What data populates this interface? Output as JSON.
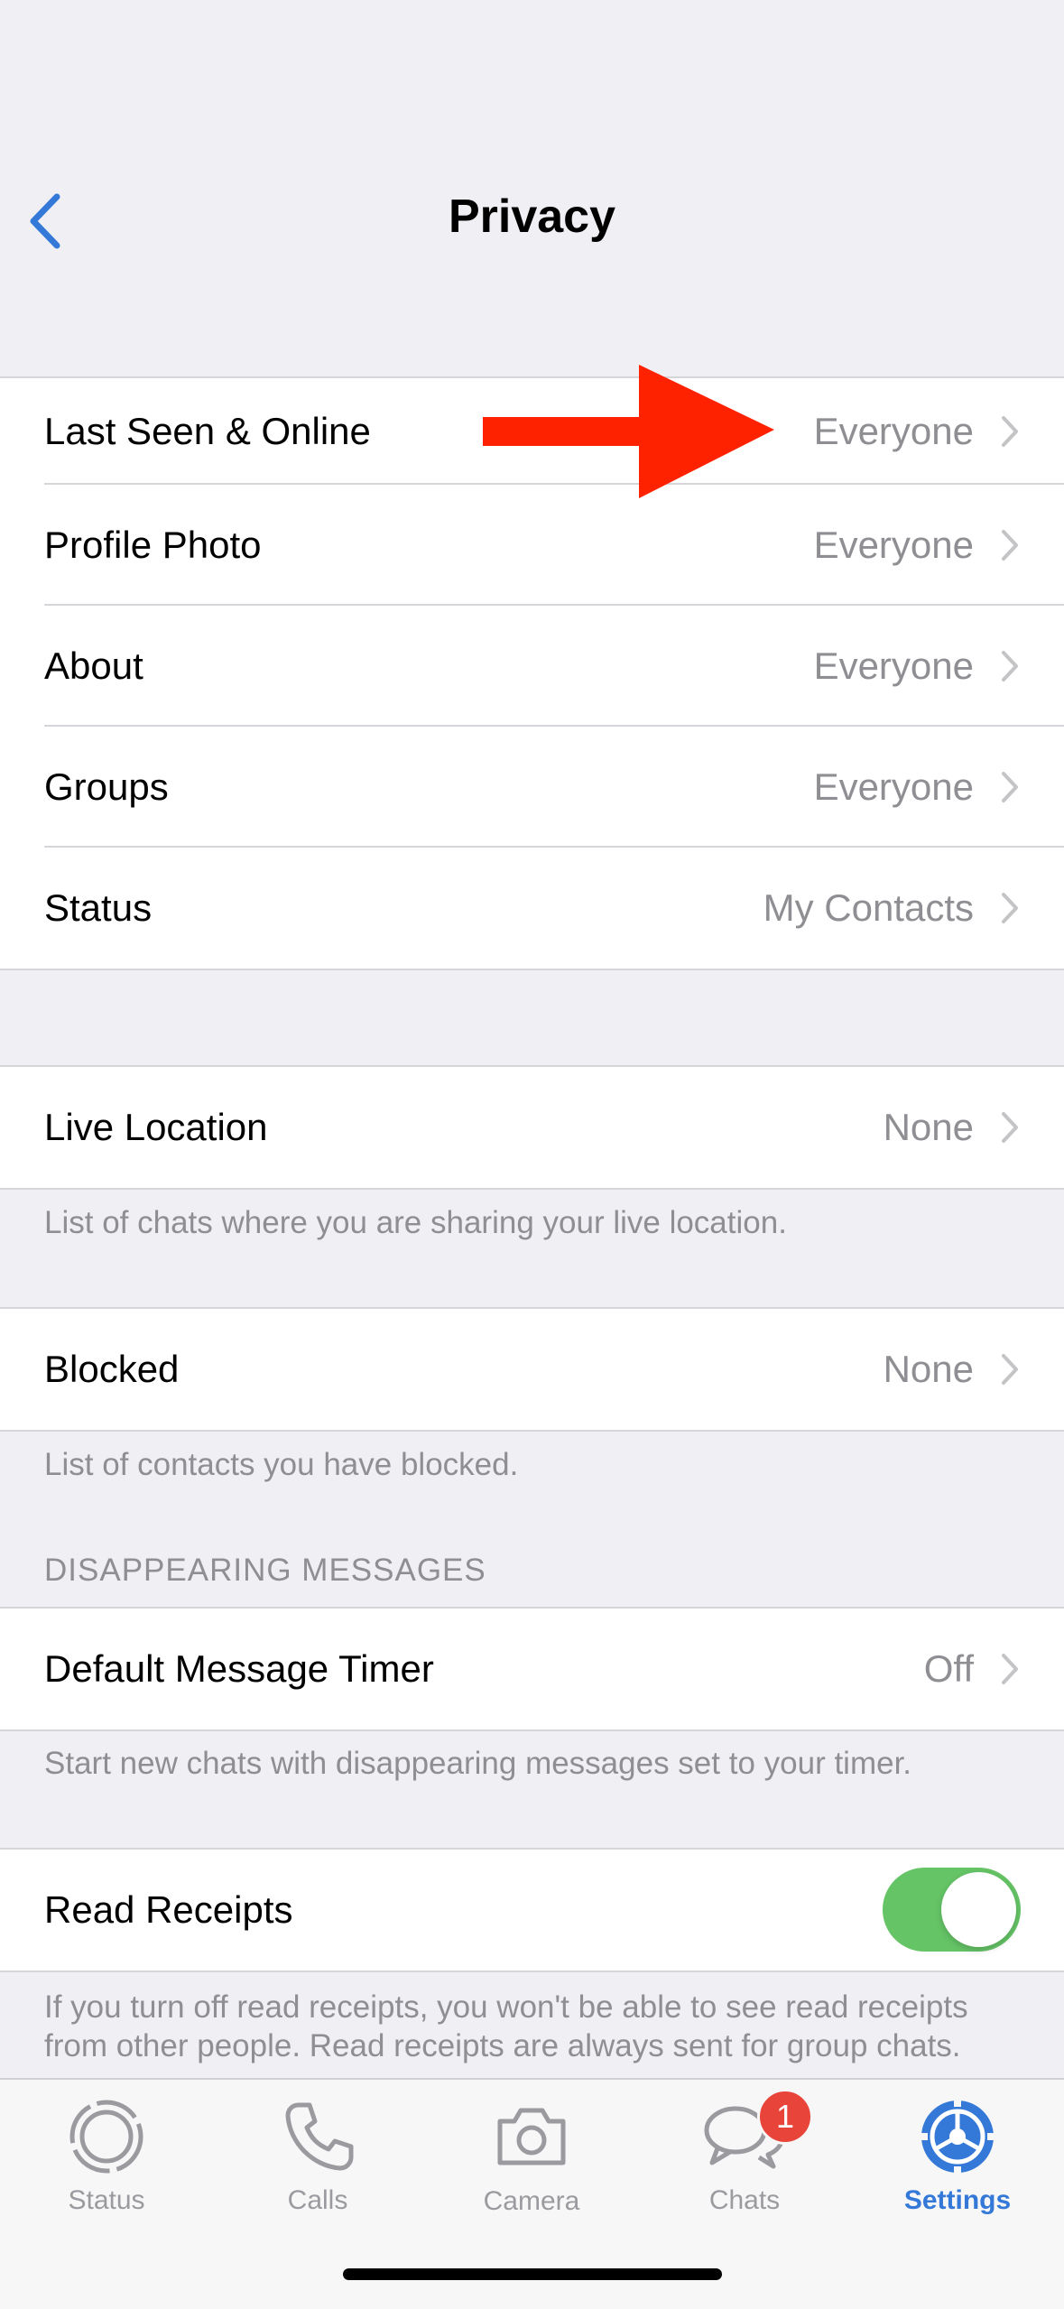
{
  "nav": {
    "title": "Privacy"
  },
  "visibility_settings": [
    {
      "label": "Last Seen & Online",
      "value": "Everyone"
    },
    {
      "label": "Profile Photo",
      "value": "Everyone"
    },
    {
      "label": "About",
      "value": "Everyone"
    },
    {
      "label": "Groups",
      "value": "Everyone"
    },
    {
      "label": "Status",
      "value": "My Contacts"
    }
  ],
  "live_location": {
    "label": "Live Location",
    "value": "None",
    "footer": "List of chats where you are sharing your live location."
  },
  "blocked": {
    "label": "Blocked",
    "value": "None",
    "footer": "List of contacts you have blocked."
  },
  "disappearing": {
    "header": "DISAPPEARING MESSAGES",
    "label": "Default Message Timer",
    "value": "Off",
    "footer": "Start new chats with disappearing messages set to your timer."
  },
  "read_receipts": {
    "label": "Read Receipts",
    "enabled": true,
    "footer": "If you turn off read receipts, you won't be able to see read receipts from other people. Read receipts are always sent for group chats."
  },
  "tab_bar": {
    "tabs": [
      {
        "label": "Status",
        "icon": "status-icon"
      },
      {
        "label": "Calls",
        "icon": "phone-icon"
      },
      {
        "label": "Camera",
        "icon": "camera-icon"
      },
      {
        "label": "Chats",
        "icon": "chat-bubbles-icon",
        "badge": "1"
      },
      {
        "label": "Settings",
        "icon": "gear-icon",
        "active": true
      }
    ]
  },
  "colors": {
    "accent": "#3478d8",
    "toggle_on": "#65c466",
    "badge": "#e8443a",
    "annotation_arrow": "#ff2200",
    "secondary_text": "#8e8e93"
  }
}
